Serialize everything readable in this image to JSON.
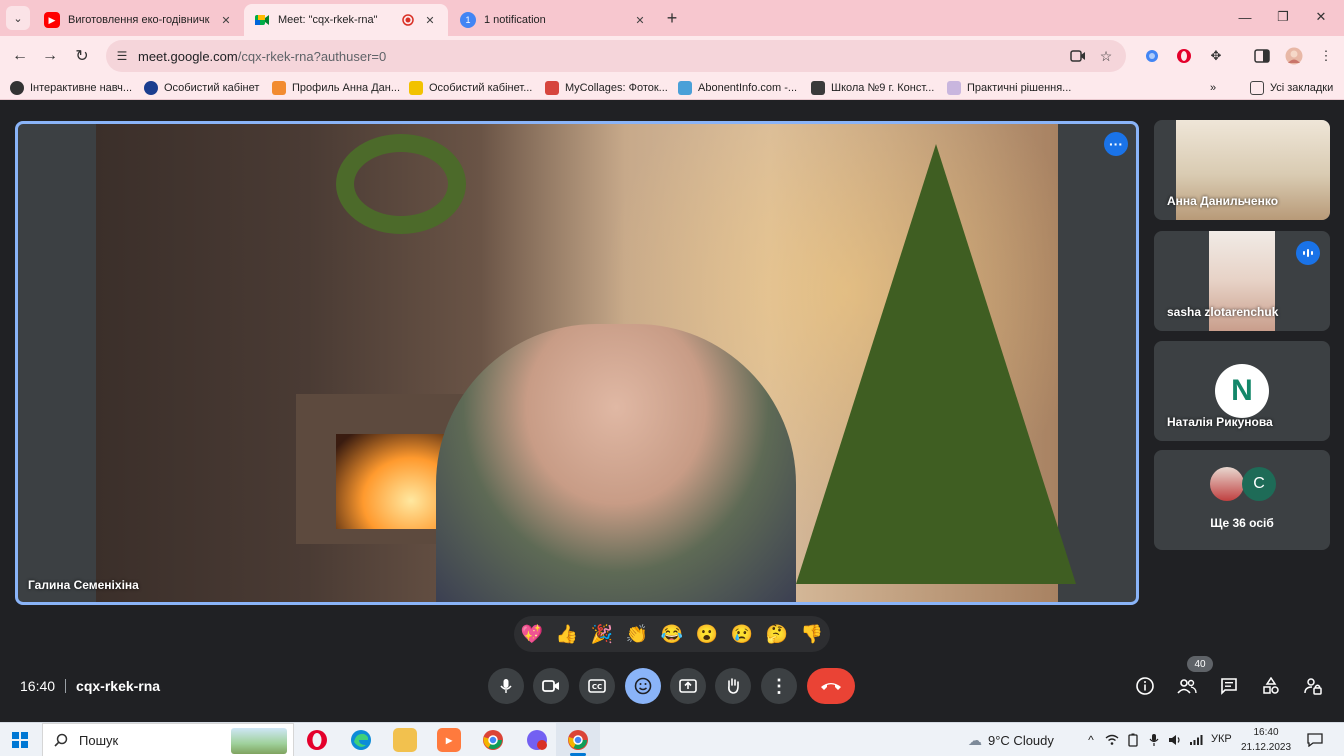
{
  "browser": {
    "tabs": [
      {
        "title": "Виготовлення еко-годівничк",
        "favicon": "youtube-icon"
      },
      {
        "title": "Meet: \"cqx-rkek-rna\"",
        "favicon": "meet-icon",
        "recording": true
      },
      {
        "title": "1 notification",
        "favicon": "notification-icon",
        "badge": "1"
      }
    ],
    "url_host": "meet.google.com",
    "url_path": "/cqx-rkek-rna?authuser=0",
    "bookmarks": [
      "Інтерактивне навч...",
      "Особистий кабінет",
      "Профиль Анна Дан...",
      "Особистий кабінет...",
      "MyCollages: Фоток...",
      "AbonentInfo.com -...",
      "Школа №9 г. Конст...",
      "Практичні рішення..."
    ],
    "all_bookmarks_label": "Усі закладки"
  },
  "meet": {
    "main_speaker": "Галина Семеніхіна",
    "participants": [
      {
        "name": "Анна Данильченко"
      },
      {
        "name": "sasha zlotarenchuk"
      },
      {
        "name": "Наталія Рикунова",
        "avatar_letter": "N"
      }
    ],
    "more_participants": "Ще 36 осіб",
    "more_avatar_letter": "C",
    "reactions": [
      "💖",
      "👍",
      "🎉",
      "👏",
      "😂",
      "😮",
      "😢",
      "🤔",
      "👎"
    ],
    "time": "16:40",
    "meeting_code": "cqx-rkek-rna",
    "people_count": "40",
    "colors": {
      "accent": "#8ab4f8",
      "hangup": "#ea4335",
      "badge": "#1a73e8"
    }
  },
  "taskbar": {
    "search_placeholder": "Пошук",
    "weather": "9°C  Cloudy",
    "language": "УКР",
    "time": "16:40",
    "date": "21.12.2023"
  }
}
